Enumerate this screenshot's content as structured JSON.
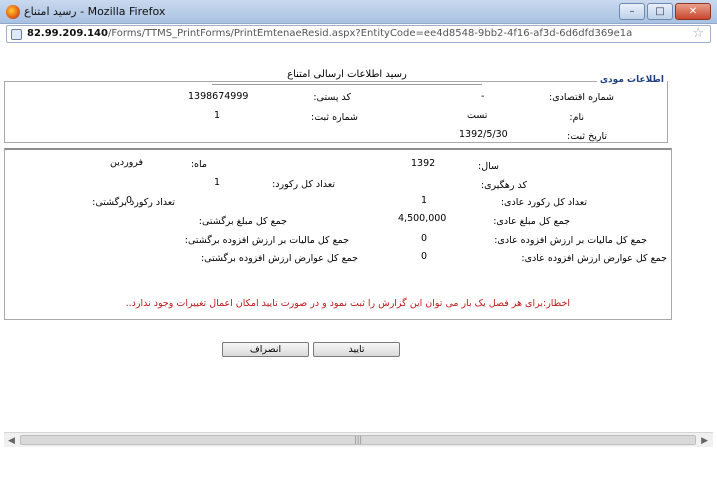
{
  "window": {
    "title": "رسید امتناع - Mozilla Firefox",
    "minimize": "–",
    "maximize": "□",
    "close": "✕"
  },
  "address": {
    "host": "82.99.209.140",
    "path": "/Forms/TTMS_PrintForms/PrintEmtenaeResid.aspx?EntityCode=ee4d8548-9bb2-4f16-af3d-6d6dfd369e1a"
  },
  "page": {
    "title": "رسید اطلاعات ارسالی امتناع",
    "legend": "اطلاعات مودی"
  },
  "taxpayer": {
    "economic_code_label": "شماره اقتصادی:",
    "economic_code_value": "-",
    "postal_code_label": "کد پستی:",
    "postal_code_value": "1398674999",
    "name_label": "نام:",
    "name_value": "تست",
    "reg_number_label": "شماره ثبت:",
    "reg_number_value": "1",
    "reg_date_label": "تاریخ ثبت:",
    "reg_date_value": "1392/5/30"
  },
  "details": {
    "year_label": "سال:",
    "year_value": "1392",
    "month_label": "ماه:",
    "month_value": "فروردین",
    "tracking_label": "کد رهگیری:",
    "total_records_label": "تعداد کل رکورد:",
    "total_records_value": "1",
    "normal_records_label": "تعداد کل رکورد عادی:",
    "normal_records_value": "1",
    "return_records_label": "تعداد رکورد برگشتی:",
    "return_records_value": "0",
    "normal_amount_label": "جمع کل مبلغ عادی:",
    "normal_amount_value": "4,500,000",
    "return_amount_label": "جمع کل مبلغ برگشتی:",
    "normal_vat_label": "جمع کل مالیات بر ارزش افزوده عادی:",
    "normal_vat_value": "0",
    "return_vat_label": "جمع کل مالیات بر ارزش افزوده برگشتی:",
    "normal_tolls_label": "جمع کل عوارض ارزش افزوده عادی:",
    "normal_tolls_value": "0",
    "return_tolls_label": "جمع کل عوارض ارزش افزوده برگشتی:"
  },
  "warning": "اخطار:برای هر فصل یک بار می توان این گزارش را ثبت نمود و در صورت تایید امکان اعمال تغییرات وجود ندارد..",
  "buttons": {
    "confirm": "تایید",
    "cancel": "انصراف"
  },
  "scrollbar": {
    "left_arrow": "◀",
    "right_arrow": "▶",
    "grip": "|||"
  }
}
